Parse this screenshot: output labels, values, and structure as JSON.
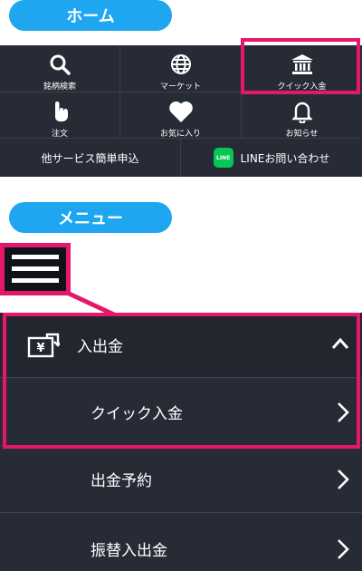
{
  "home": {
    "title": "ホーム",
    "items": [
      {
        "label": "銘柄検索",
        "icon": "search-icon"
      },
      {
        "label": "マーケット",
        "icon": "globe-icon"
      },
      {
        "label": "クイック入金",
        "icon": "bank-icon"
      },
      {
        "label": "注文",
        "icon": "tap-hand-icon"
      },
      {
        "label": "お気に入り",
        "icon": "heart-icon"
      },
      {
        "label": "お知らせ",
        "icon": "bell-icon"
      }
    ],
    "other_services": "他サービス簡単申込",
    "line_contact": "LINEお問い合わせ",
    "line_logo_text": "LINE"
  },
  "menu_section": {
    "title": "メニュー"
  },
  "menu": {
    "items": [
      {
        "label": "入出金",
        "icon": "yen-transfer-icon"
      },
      {
        "label": "クイック入金"
      },
      {
        "label": "出金予約"
      },
      {
        "label": "振替入出金"
      }
    ]
  },
  "colors": {
    "accent": "#1ea7f0",
    "highlight": "#e5176c",
    "panel": "#272b36",
    "line_green": "#06c755"
  }
}
